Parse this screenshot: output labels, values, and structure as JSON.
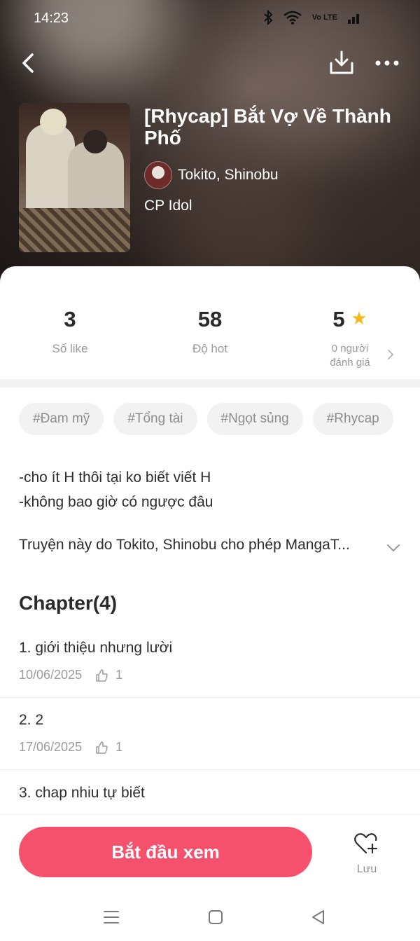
{
  "status_bar": {
    "time": "14:23",
    "bluetooth_icon": "bluetooth-icon",
    "wifi_icon": "wifi-icon",
    "network": "Vo LTE",
    "signal_icon": "signal-icon"
  },
  "header": {
    "back_icon": "chevron-left-icon",
    "download_icon": "download-icon",
    "more_icon": "more-horizontal-icon"
  },
  "story": {
    "title": "[Rhycap] Bắt Vợ Về Thành Phố",
    "author": "Tokito, Shinobu",
    "category": "CP Idol"
  },
  "stats": {
    "likes_value": "3",
    "likes_label": "Số like",
    "hot_value": "58",
    "hot_label": "Độ hot",
    "rating_value": "5",
    "rating_label_line1": "0 người",
    "rating_label_line2": "đánh giá"
  },
  "tags": [
    "#Đam mỹ",
    "#Tổng tài",
    "#Ngọt sủng",
    "#Rhycap"
  ],
  "description": {
    "line1": "-cho ít H thôi tại ko biết viết H",
    "line2": "-không bao giờ có ngược đâu",
    "license": "Truyện này do Tokito, Shinobu cho phép MangaT..."
  },
  "chapters": {
    "heading": "Chapter(4)",
    "items": [
      {
        "title": "1. giới thiệu nhưng lười",
        "date": "10/06/2025",
        "likes": "1"
      },
      {
        "title": "2. 2",
        "date": "17/06/2025",
        "likes": "1"
      },
      {
        "title": "3. chap nhiu tự biết"
      }
    ]
  },
  "actions": {
    "start_label": "Bắt đầu xem",
    "save_label": "Lưu"
  },
  "colors": {
    "accent": "#f5506c",
    "star": "#f6b819",
    "muted": "#9a9a9a"
  }
}
